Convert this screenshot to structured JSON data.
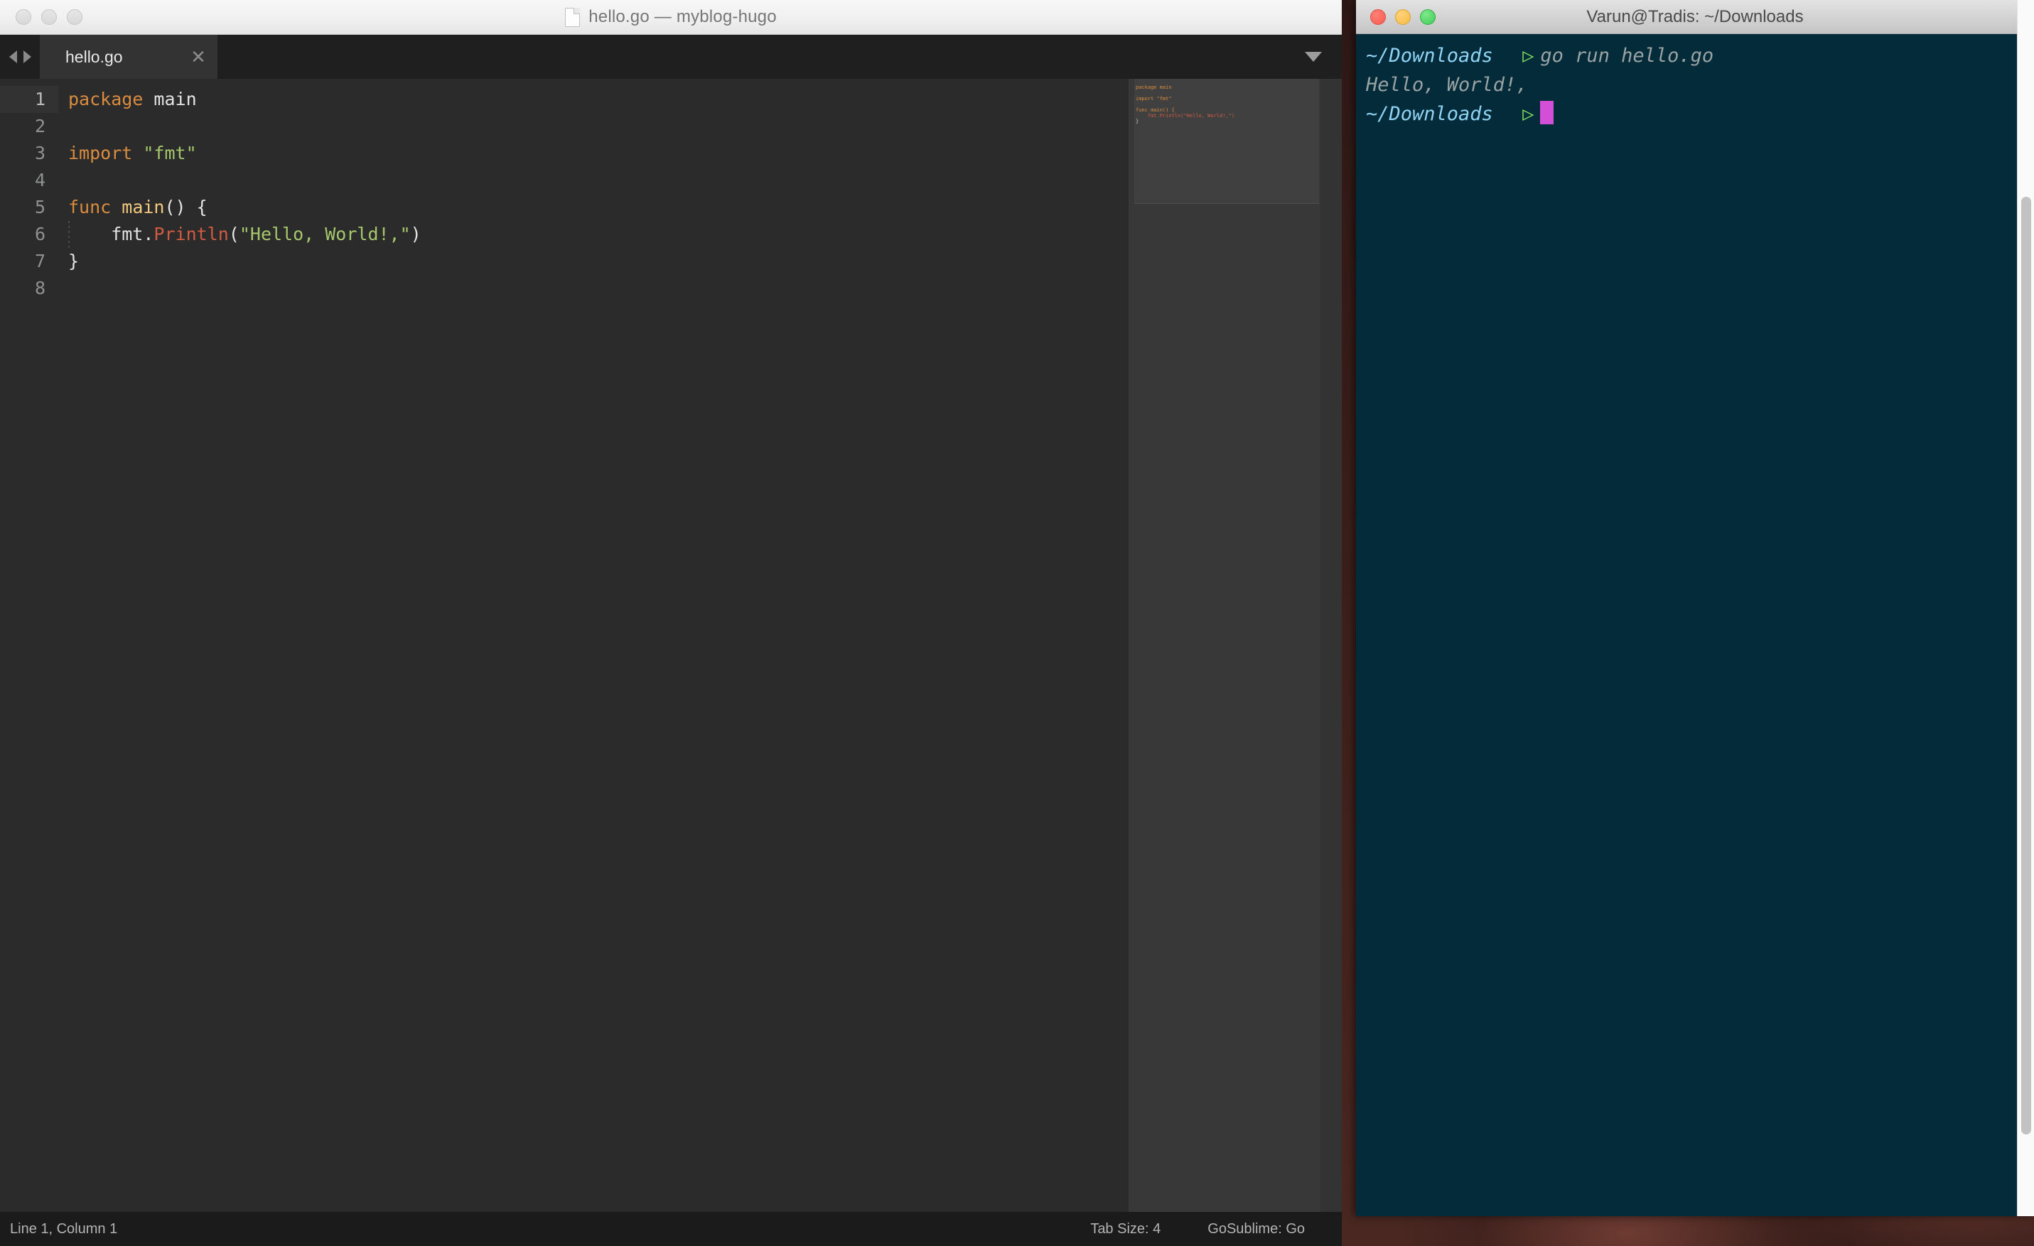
{
  "editor_window": {
    "title": "hello.go — myblog-hugo",
    "doc_icon": "document-icon",
    "traffic_lights": [
      "close",
      "minimize",
      "zoom"
    ],
    "tab": {
      "label": "hello.go",
      "close_glyph": "✕",
      "nav_back_icon": "triangle-left-icon",
      "nav_forward_icon": "triangle-right-icon",
      "menu_icon": "chevron-down-icon"
    },
    "gutter": [
      "1",
      "2",
      "3",
      "4",
      "5",
      "6",
      "7",
      "8"
    ],
    "active_line": 1,
    "code_lines": [
      {
        "n": 1,
        "tokens": [
          {
            "t": "package",
            "c": "kw"
          },
          {
            "t": " ",
            "c": "txt"
          },
          {
            "t": "main",
            "c": "txt"
          }
        ]
      },
      {
        "n": 2,
        "tokens": []
      },
      {
        "n": 3,
        "tokens": [
          {
            "t": "import",
            "c": "kw"
          },
          {
            "t": " ",
            "c": "txt"
          },
          {
            "t": "\"fmt\"",
            "c": "str"
          }
        ]
      },
      {
        "n": 4,
        "tokens": []
      },
      {
        "n": 5,
        "tokens": [
          {
            "t": "func",
            "c": "kw"
          },
          {
            "t": " ",
            "c": "txt"
          },
          {
            "t": "main",
            "c": "fn"
          },
          {
            "t": "() {",
            "c": "pun"
          }
        ]
      },
      {
        "n": 6,
        "tokens": [
          {
            "t": "    fmt.",
            "c": "txt"
          },
          {
            "t": "Println",
            "c": "call"
          },
          {
            "t": "(",
            "c": "pun"
          },
          {
            "t": "\"Hello, World!,\"",
            "c": "str"
          },
          {
            "t": ")",
            "c": "pun"
          }
        ]
      },
      {
        "n": 7,
        "tokens": [
          {
            "t": "}",
            "c": "pun"
          }
        ]
      },
      {
        "n": 8,
        "tokens": []
      }
    ],
    "minimap_lines": [
      "package main",
      "",
      "import \"fmt\"",
      "",
      "func main() {",
      "    fmt.Println(\"Hello, World!,\")",
      "}"
    ],
    "status_bar": {
      "caret": "Line 1, Column 1",
      "tab_size": "Tab Size: 4",
      "syntax": "GoSublime: Go"
    },
    "colors": {
      "background": "#2b2b2b",
      "gutter_active": "#323232",
      "keyword": "#d98c3f",
      "function": "#f2c97d",
      "string": "#a6c76c",
      "call": "#cf5b43",
      "text": "#e3e3e3",
      "minimap_bg": "#383838",
      "tab_active": "#333333",
      "tabbar_bg": "#1f1f1f",
      "statusbar_bg": "#1b1b1b"
    }
  },
  "terminal_window": {
    "title": "Varun@Tradis: ~/Downloads",
    "traffic_lights": [
      "close",
      "minimize",
      "zoom"
    ],
    "prompt_arrow": "▷",
    "lines": [
      {
        "type": "prompt",
        "path": "~/Downloads",
        "arrow": "▷",
        "command": "go run hello.go"
      },
      {
        "type": "output",
        "text": "Hello, World!,"
      },
      {
        "type": "prompt",
        "path": "~/Downloads",
        "arrow": "▷",
        "command": "",
        "cursor": true
      }
    ],
    "colors": {
      "background": "#042b3a",
      "path": "#90d4f5",
      "arrow": "#7ee05f",
      "command": "#9aa3a3",
      "output": "#9aa3a3",
      "cursor": "#d44fd8"
    }
  },
  "scrollbar": {
    "track_color": "#fafafa",
    "thumb_color": "#c2c2c2"
  }
}
